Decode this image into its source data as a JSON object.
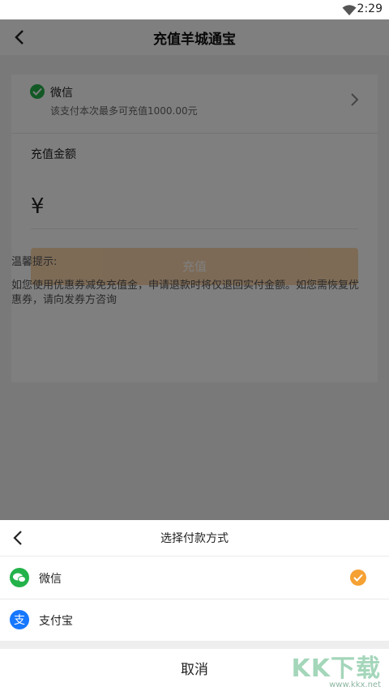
{
  "status_bar": {
    "time": "2:29"
  },
  "nav": {
    "title": "充值羊城通宝"
  },
  "payment": {
    "method": "微信",
    "limit_text": "该支付本次最多可充值1000.00元"
  },
  "amount": {
    "label": "充值金额",
    "currency_symbol": "¥"
  },
  "recharge_button": "充值",
  "tips": {
    "title": "温馨提示:",
    "text": "如您使用优惠券减免充值金，申请退款时将仅退回实付金额。如您需恢复优惠券，请向发券方咨询"
  },
  "sheet": {
    "title": "选择付款方式",
    "options": [
      {
        "label": "微信",
        "icon": "wechat-icon",
        "selected": true
      },
      {
        "label": "支付宝",
        "icon": "alipay-icon",
        "selected": false
      }
    ],
    "cancel": "取消"
  },
  "watermark": {
    "big": "KK下载",
    "small": "www.kkx.net"
  },
  "colors": {
    "wechat": "#24b24a",
    "alipay": "#1677ff",
    "accent": "#f5a133",
    "overlay": "rgba(0,0,0,0.5)"
  }
}
